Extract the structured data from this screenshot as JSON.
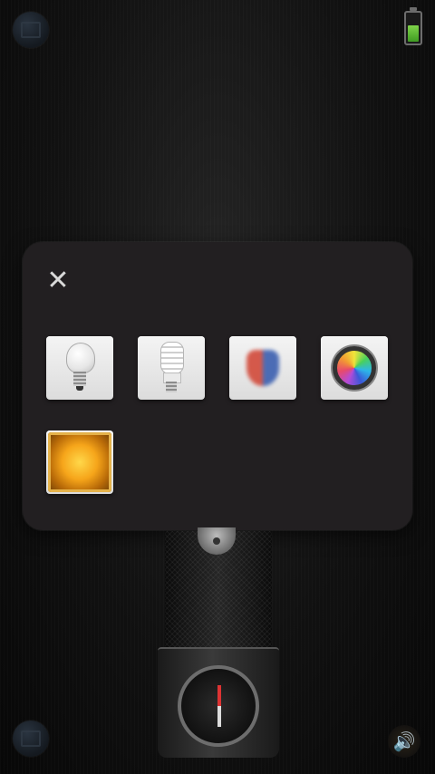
{
  "status_bar": {
    "battery_level": 0.55,
    "battery_color": "#5bbf34"
  },
  "top_left_button": {
    "icon": "menu-icon"
  },
  "bottom_left_button": {
    "icon": "grid-icon"
  },
  "sound_button": {
    "icon": "speaker-icon",
    "glyph": "🔊"
  },
  "dialog": {
    "close_glyph": "✕",
    "options": [
      {
        "name": "incandescent-bulb",
        "icon": "bulb-icon"
      },
      {
        "name": "compact-fluorescent-bulb",
        "icon": "cfl-bulb-icon"
      },
      {
        "name": "shield-light",
        "icon": "shield-icon"
      },
      {
        "name": "color-light",
        "icon": "color-wheel-icon"
      },
      {
        "name": "amber-warning-light",
        "icon": "amber-light-icon"
      }
    ]
  },
  "flashlight": {
    "icon": "flashlight-icon",
    "dial_icon": "compass-icon"
  }
}
